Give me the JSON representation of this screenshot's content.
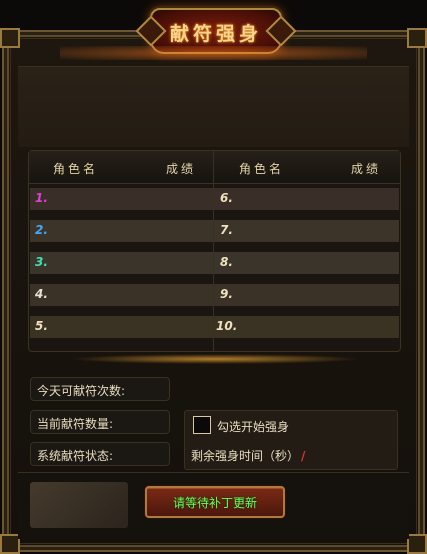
{
  "title": "献符强身",
  "table": {
    "headers": {
      "left_name": "角色名",
      "left_score": "成绩",
      "right_name": "角色名",
      "right_score": "成绩"
    },
    "rows": [
      {
        "left_rank": "1.",
        "left_color": "#e040d0",
        "right_rank": "6.",
        "right_color": "#f0e0c0"
      },
      {
        "left_rank": "2.",
        "left_color": "#40a8ff",
        "right_rank": "7.",
        "right_color": "#f0e0c0"
      },
      {
        "left_rank": "3.",
        "left_color": "#40e0b0",
        "right_rank": "8.",
        "right_color": "#f0e0c0"
      },
      {
        "left_rank": "4.",
        "left_color": "#e8e0d0",
        "right_rank": "9.",
        "right_color": "#f0e0c0"
      },
      {
        "left_rank": "5.",
        "left_color": "#f0e0c0",
        "right_rank": "10.",
        "right_color": "#f0e0c0"
      }
    ]
  },
  "info": {
    "today_available": "今天可献符次数:",
    "current_count": "当前献符数量:",
    "system_status": "系统献符状态:"
  },
  "options": {
    "checkbox_label": "勾选开始强身",
    "checkbox_checked": false,
    "remaining_label": "剩余强身时间（秒）",
    "remaining_value": "/"
  },
  "button_label": "请等待补丁更新",
  "colors": {
    "accent_green": "#6cff5a",
    "title_gold": "#f6d58a",
    "frame_gold": "#b08a3c"
  }
}
